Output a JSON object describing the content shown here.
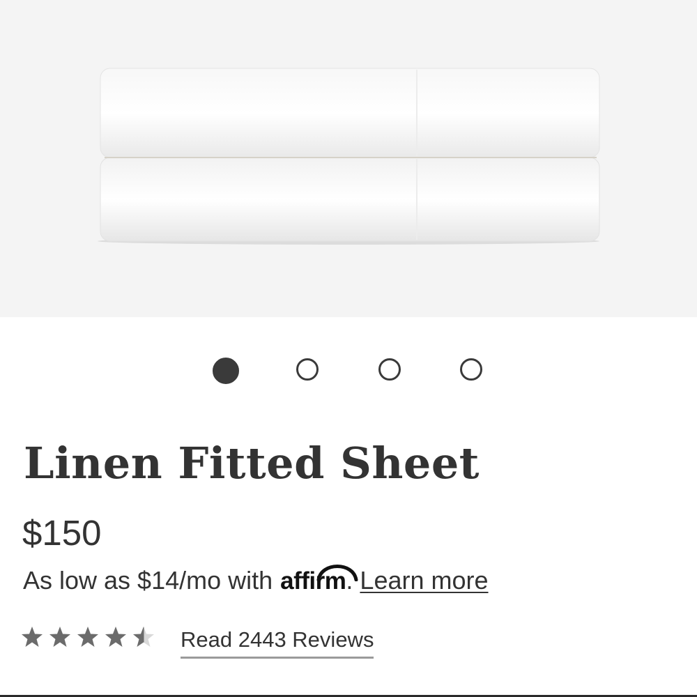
{
  "product": {
    "image_icon": "folded-sheets-image",
    "carousel": {
      "count": 4,
      "active_index": 0
    },
    "title": "Linen Fitted Sheet",
    "price": "$150",
    "financing": {
      "prefix": "As low as $14/mo with",
      "provider_logo_text": "affirm",
      "suffix": ".",
      "learn_more": "Learn more"
    },
    "rating": {
      "value": 4.5,
      "max": 5,
      "color": "#6b6b6b"
    },
    "reviews_link": "Read 2443 Reviews"
  }
}
